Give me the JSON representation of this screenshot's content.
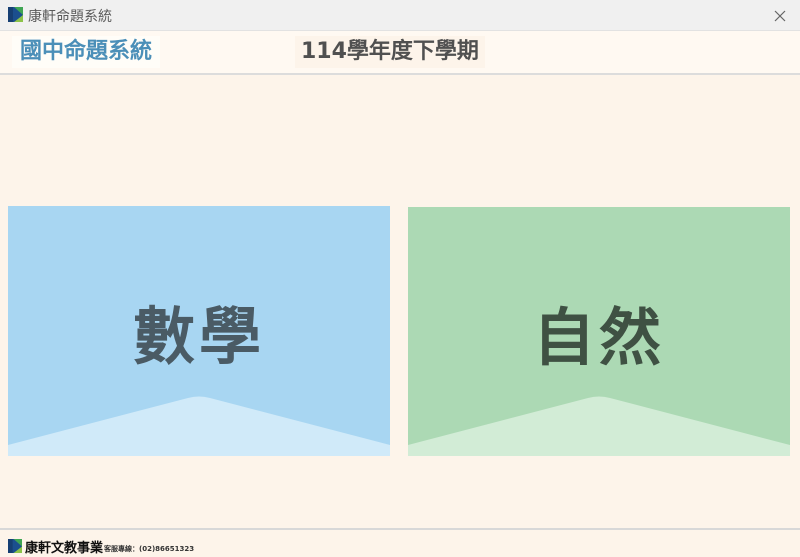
{
  "window": {
    "title": "康軒命題系統"
  },
  "header": {
    "system_title": "國中命題系統",
    "semester": "114學年度下學期"
  },
  "cards": [
    {
      "label": "數學",
      "color": "#a8d6f2",
      "chevron_color": "#d0eaf9"
    },
    {
      "label": "自然",
      "color": "#acd9b4",
      "chevron_color": "#d2ecd6"
    }
  ],
  "footer": {
    "brand": "康軒文教事業",
    "phone": "客服專線：(02)86651323"
  },
  "colors": {
    "background": "#fdf4ea",
    "title_accent": "#4b8fb8",
    "logo_blue": "#1b4f8e",
    "logo_green": "#3fa553"
  }
}
